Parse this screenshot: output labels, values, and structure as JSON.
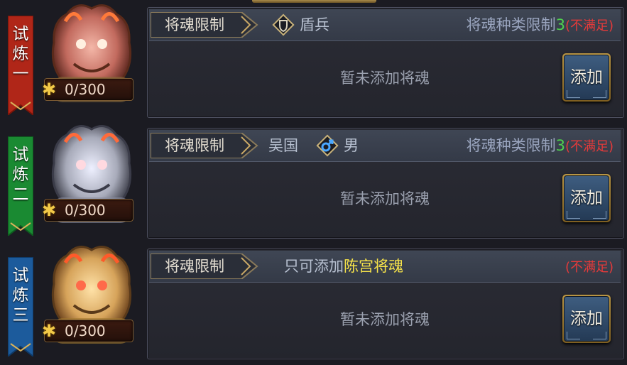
{
  "rows": [
    {
      "banner": "试炼一",
      "banner_color": "#b02618",
      "emblem_color": "#c26a5e",
      "counter": "0/300",
      "tag": "将魂限制",
      "filters": [
        {
          "icon": "shield-icon",
          "text": "盾兵"
        }
      ],
      "requirement": {
        "label": "将魂种类限制",
        "num": "3",
        "status": "(不满足)"
      },
      "empty": "暂未添加将魂",
      "button": "添加"
    },
    {
      "banner": "试炼二",
      "banner_color": "#1a8a32",
      "emblem_color": "#a7aab9",
      "counter": "0/300",
      "tag": "将魂限制",
      "filters": [
        {
          "text": "吴国"
        },
        {
          "icon": "male-icon",
          "text": "男"
        }
      ],
      "requirement": {
        "label": "将魂种类限制",
        "num": "3",
        "status": "(不满足)"
      },
      "empty": "暂未添加将魂",
      "button": "添加"
    },
    {
      "banner": "试炼三",
      "banner_color": "#1c5b9c",
      "emblem_color": "#d6a35a",
      "counter": "0/300",
      "tag": "将魂限制",
      "only": {
        "prefix": "只可添加",
        "highlight": "陈宫将魂"
      },
      "requirement": {
        "label": "",
        "num": "",
        "status": "(不满足)"
      },
      "empty": "暂未添加将魂",
      "button": "添加"
    }
  ]
}
